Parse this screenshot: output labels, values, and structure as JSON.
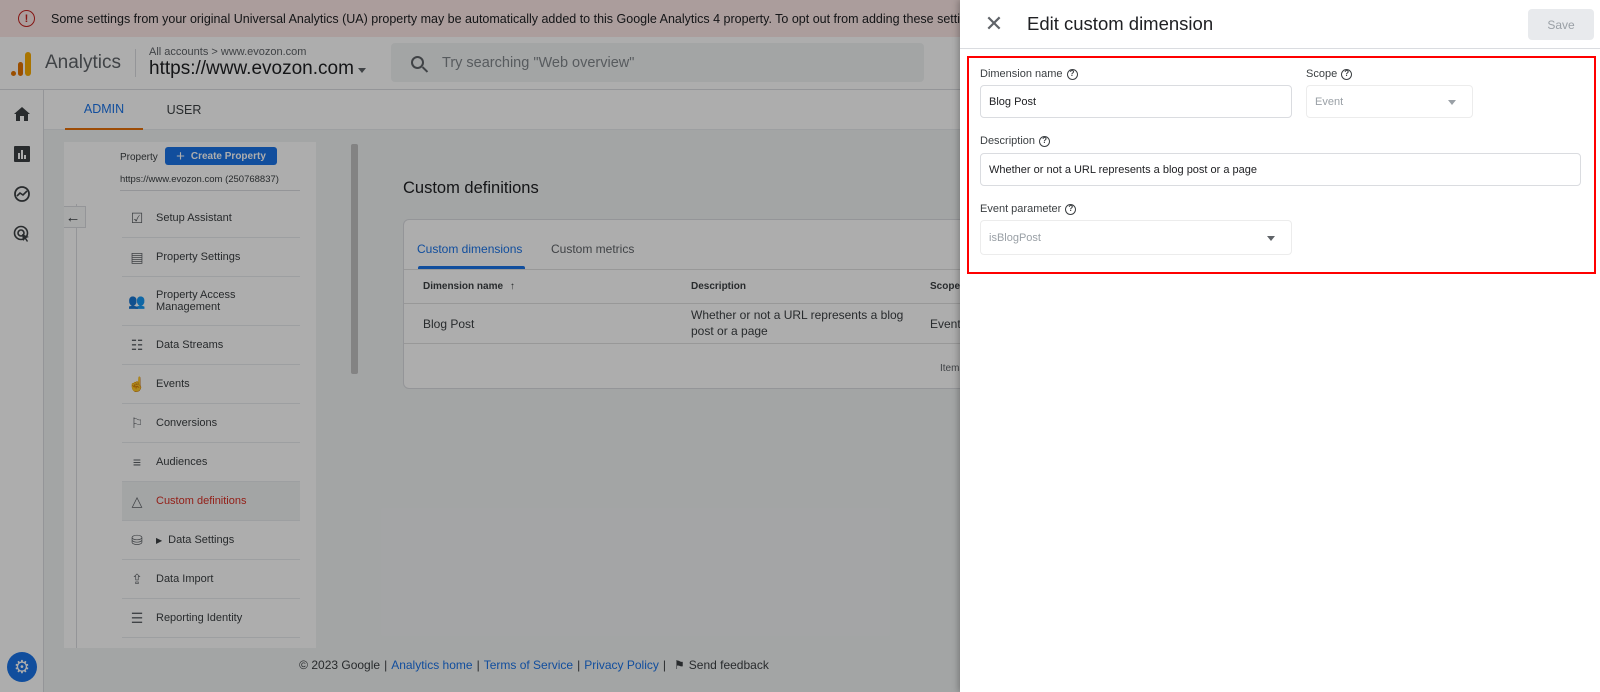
{
  "banner": {
    "icon": "error-icon",
    "text": "Some settings from your original Universal Analytics (UA) property may be automatically added to this Google Analytics 4 property. To opt out from adding these settings and"
  },
  "header": {
    "app_name": "Analytics",
    "breadcrumb": "All accounts > www.evozon.com",
    "property_name": "https://www.evozon.com",
    "search_placeholder": "Try searching \"Web overview\""
  },
  "rail": {
    "items": [
      {
        "icon": "home-icon",
        "label": "Home"
      },
      {
        "icon": "reports-icon",
        "label": "Reports"
      },
      {
        "icon": "explore-icon",
        "label": "Explore"
      },
      {
        "icon": "advertising-icon",
        "label": "Advertising"
      }
    ],
    "settings_icon": "gear-icon"
  },
  "topnav": {
    "tabs": [
      {
        "label": "ADMIN",
        "active": true
      },
      {
        "label": "USER",
        "active": false
      }
    ]
  },
  "navpanel": {
    "property_label": "Property",
    "create_button": "Create Property",
    "property_url": "https://www.evozon.com (250768837)",
    "items": [
      {
        "label": "Setup Assistant",
        "icon": "clipboard-check-icon"
      },
      {
        "label": "Property Settings",
        "icon": "property-settings-icon"
      },
      {
        "label": "Property Access Management",
        "icon": "people-icon"
      },
      {
        "label": "Data Streams",
        "icon": "data-streams-icon"
      },
      {
        "label": "Events",
        "icon": "touch-icon"
      },
      {
        "label": "Conversions",
        "icon": "flag-icon"
      },
      {
        "label": "Audiences",
        "icon": "audiences-icon"
      },
      {
        "label": "Custom definitions",
        "icon": "shapes-icon",
        "active": true
      },
      {
        "label": "Data Settings",
        "icon": "database-icon"
      },
      {
        "label": "Data Import",
        "icon": "upload-icon"
      },
      {
        "label": "Reporting Identity",
        "icon": "reporting-identity-icon"
      }
    ]
  },
  "main": {
    "title": "Custom definitions",
    "tabs": [
      {
        "label": "Custom dimensions",
        "active": true
      },
      {
        "label": "Custom metrics",
        "active": false
      }
    ],
    "table": {
      "columns": [
        "Dimension name",
        "Description",
        "Scope"
      ],
      "rows": [
        {
          "name": "Blog Post",
          "description": "Whether or not a URL represents a blog post or a page",
          "scope": "Event"
        }
      ]
    },
    "items_per_page_label": "Items per page"
  },
  "footer": {
    "copyright": "© 2023 Google",
    "links": [
      "Analytics home",
      "Terms of Service",
      "Privacy Policy"
    ],
    "feedback": "Send feedback"
  },
  "drawer": {
    "title": "Edit custom dimension",
    "save_label": "Save",
    "dimension_name_label": "Dimension name",
    "dimension_name_value": "Blog Post",
    "scope_label": "Scope",
    "scope_value": "Event",
    "description_label": "Description",
    "description_value": "Whether or not a URL represents a blog post or a page",
    "event_parameter_label": "Event parameter",
    "event_parameter_value": "isBlogPost"
  }
}
